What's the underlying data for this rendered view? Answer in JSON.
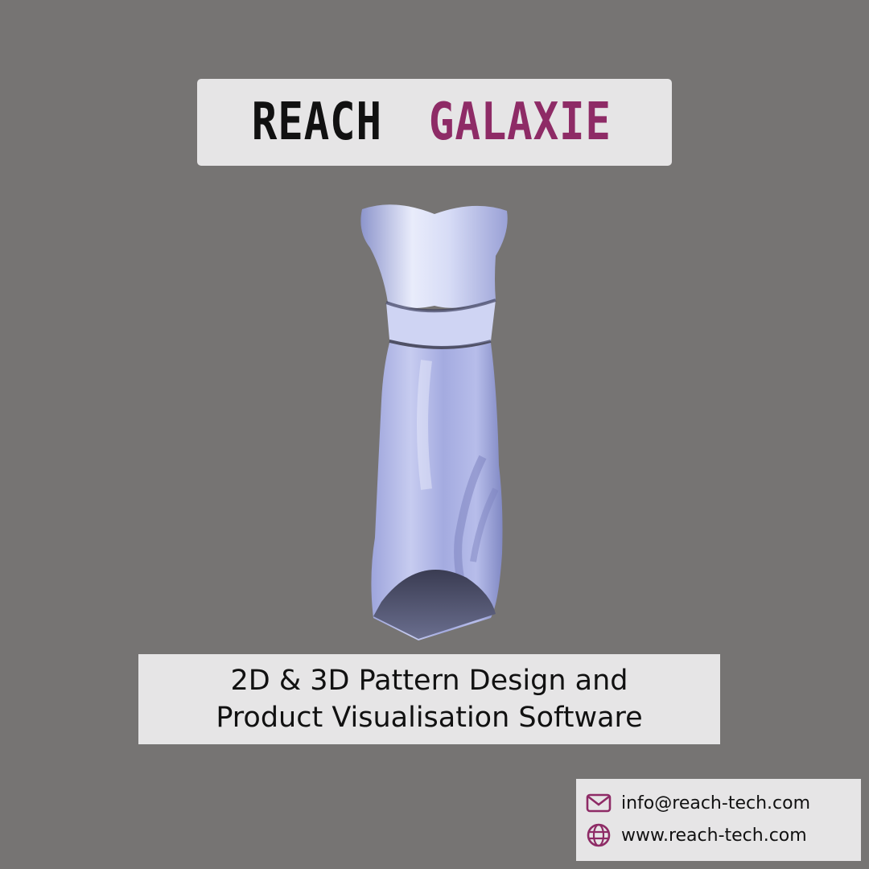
{
  "title": {
    "word_1": "REACH",
    "word_2": "GALAXIE",
    "accent_color": "#8e2b66"
  },
  "subtitle": {
    "line_1": "2D & 3D Pattern Design and",
    "line_2": "Product Visualisation Software"
  },
  "contact": {
    "email": {
      "icon": "envelope-icon",
      "text": "info@reach-tech.com"
    },
    "website": {
      "icon": "globe-icon",
      "text": "www.reach-tech.com"
    }
  },
  "colors": {
    "background": "#767473",
    "panel": "#e6e5e6",
    "icon": "#8e2b66",
    "garment": "#aab0e0"
  }
}
